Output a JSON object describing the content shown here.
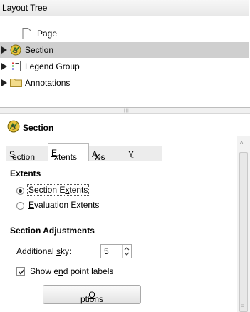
{
  "tree": {
    "header": "Layout Tree",
    "items": [
      {
        "label": "Page",
        "icon": "page-icon",
        "expandable": false,
        "selected": false
      },
      {
        "label": "Section",
        "icon": "section-icon",
        "expandable": true,
        "selected": true
      },
      {
        "label": "Legend Group",
        "icon": "legend-icon",
        "expandable": true,
        "selected": false
      },
      {
        "label": "Annotations",
        "icon": "folder-icon",
        "expandable": true,
        "selected": false
      }
    ]
  },
  "properties": {
    "title": "Section",
    "tabs": [
      {
        "pre": "",
        "mn": "S",
        "post": "ection"
      },
      {
        "pre": "",
        "mn": "E",
        "post": "xtents"
      },
      {
        "pre": "X-",
        "mn": "A",
        "post": "xis"
      },
      {
        "pre": "",
        "mn": "Y",
        "post": "-Axis"
      }
    ],
    "active_tab": "Extents",
    "extents": {
      "title": "Extents",
      "option1": {
        "pre": "Section E",
        "mn": "x",
        "post": "tents",
        "selected": true
      },
      "option2": {
        "pre": "",
        "mn": "E",
        "post": "valuation Extents",
        "selected": false
      }
    },
    "adjustments": {
      "title": "Section Adjustments",
      "sky_label": {
        "pre": "Additional ",
        "mn": "s",
        "post": "ky:"
      },
      "sky_value": "5",
      "show_labels": {
        "pre": "Show e",
        "mn": "n",
        "post": "d point labels",
        "checked": true
      },
      "options_button": {
        "pre": "",
        "mn": "O",
        "post": "ptions"
      }
    }
  },
  "colors": {
    "selection": "#cfcfcf",
    "panel": "#ffffff",
    "chrome": "#f0f0f0"
  }
}
